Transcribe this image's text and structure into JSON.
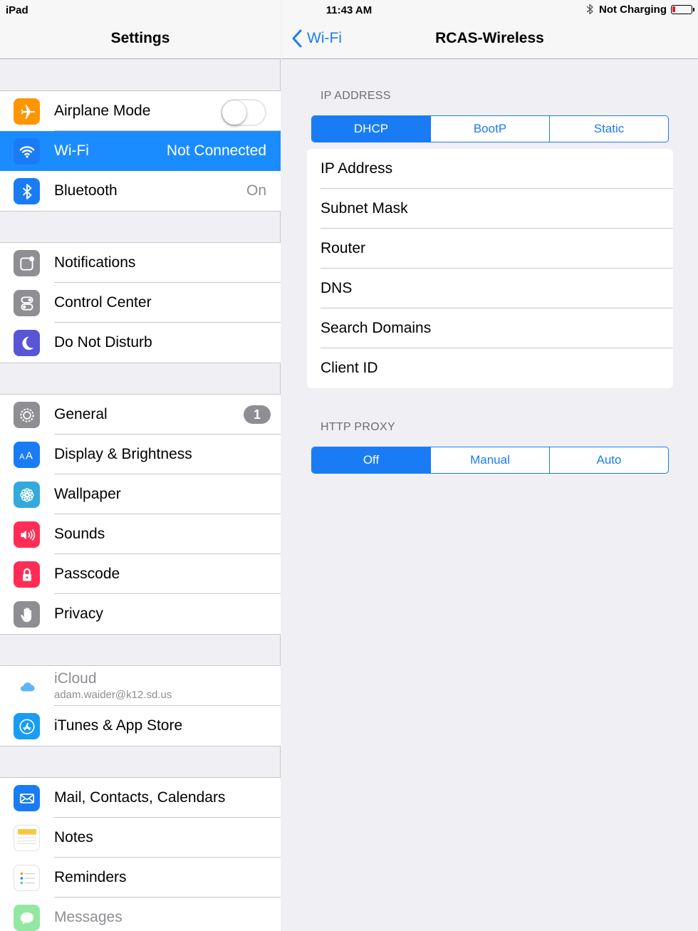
{
  "status": {
    "device": "iPad",
    "time": "11:43 AM",
    "charging": "Not Charging"
  },
  "left": {
    "title": "Settings",
    "groups": [
      {
        "items": [
          {
            "label": "Airplane Mode",
            "icon": "airplane-icon",
            "color": "#ff9500",
            "toggle": false
          },
          {
            "label": "Wi-Fi",
            "value": "Not Connected",
            "icon": "wifi-icon",
            "color": "#1a7cf5",
            "selected": true
          },
          {
            "label": "Bluetooth",
            "value": "On",
            "icon": "bluetooth-icon",
            "color": "#1a7cf5"
          }
        ]
      },
      {
        "items": [
          {
            "label": "Notifications",
            "icon": "notifications-icon",
            "color": "#8e8e93"
          },
          {
            "label": "Control Center",
            "icon": "control-center-icon",
            "color": "#8e8e93"
          },
          {
            "label": "Do Not Disturb",
            "icon": "moon-icon",
            "color": "#5856d6"
          }
        ]
      },
      {
        "items": [
          {
            "label": "General",
            "badge": "1",
            "icon": "gear-icon",
            "color": "#8e8e93"
          },
          {
            "label": "Display & Brightness",
            "icon": "display-icon",
            "color": "#1a7cf5"
          },
          {
            "label": "Wallpaper",
            "icon": "wallpaper-icon",
            "color": "#34aadc"
          },
          {
            "label": "Sounds",
            "icon": "speaker-icon",
            "color": "#ff2d55"
          },
          {
            "label": "Passcode",
            "icon": "lock-icon",
            "color": "#ff2d55"
          },
          {
            "label": "Privacy",
            "icon": "hand-icon",
            "color": "#8e8e93"
          }
        ]
      },
      {
        "items": [
          {
            "label": "iCloud",
            "sublabel": "adam.waider@k12.sd.us",
            "icon": "cloud-icon",
            "color": "#ffffff"
          },
          {
            "label": "iTunes & App Store",
            "icon": "app-store-icon",
            "color": "#1a9cf5"
          }
        ]
      },
      {
        "items": [
          {
            "label": "Mail, Contacts, Calendars",
            "icon": "mail-icon",
            "color": "#1a7cf5"
          },
          {
            "label": "Notes",
            "icon": "notes-icon",
            "color": "#ffffff"
          },
          {
            "label": "Reminders",
            "icon": "reminders-icon",
            "color": "#ffffff"
          },
          {
            "label": "Messages",
            "icon": "messages-icon",
            "color": "#4cd964"
          }
        ]
      }
    ]
  },
  "right": {
    "back_label": "Wi-Fi",
    "title": "RCAS-Wireless",
    "ip_header": "IP ADDRESS",
    "ip_modes": [
      "DHCP",
      "BootP",
      "Static"
    ],
    "ip_rows": [
      "IP Address",
      "Subnet Mask",
      "Router",
      "DNS",
      "Search Domains",
      "Client ID"
    ],
    "proxy_header": "HTTP PROXY",
    "proxy_modes": [
      "Off",
      "Manual",
      "Auto"
    ]
  }
}
